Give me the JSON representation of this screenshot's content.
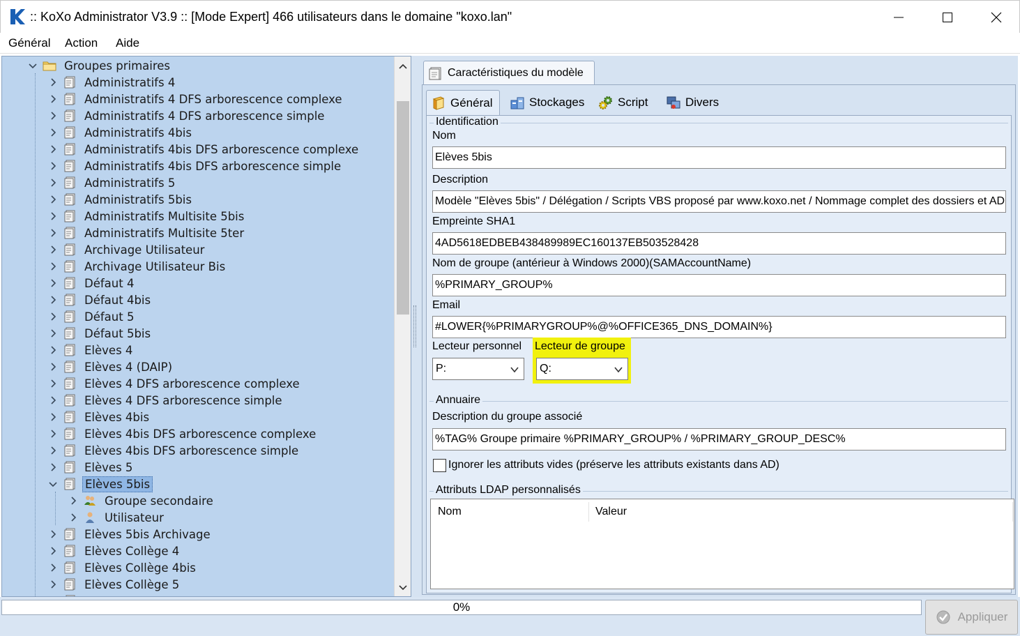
{
  "window": {
    "title": ":: KoXo Administrator V3.9 :: [Mode Expert] 466 utilisateurs dans le domaine \"koxo.lan\""
  },
  "menu": [
    "Général",
    "Action",
    "Aide"
  ],
  "tree": {
    "root_label": "Groupes primaires",
    "items": [
      "Administratifs 4",
      "Administratifs 4 DFS arborescence complexe",
      "Administratifs 4 DFS arborescence simple",
      "Administratifs 4bis",
      "Administratifs 4bis DFS arborescence complexe",
      "Administratifs 4bis DFS arborescence simple",
      "Administratifs 5",
      "Administratifs 5bis",
      "Administratifs Multisite 5bis",
      "Administratifs Multisite 5ter",
      "Archivage Utilisateur",
      "Archivage Utilisateur Bis",
      "Défaut 4",
      "Défaut 4bis",
      "Défaut 5",
      "Défaut 5bis",
      "Elèves 4",
      "Elèves 4 (DAIP)",
      "Elèves 4 DFS arborescence complexe",
      "Elèves 4 DFS arborescence simple",
      "Elèves 4bis",
      "Elèves 4bis DFS arborescence complexe",
      "Elèves 4bis DFS arborescence simple",
      "Elèves 5",
      "Elèves 5bis"
    ],
    "selected_children": [
      "Groupe secondaire",
      "Utilisateur"
    ],
    "items_after": [
      "Elèves 5bis Archivage",
      "Elèves Collège 4",
      "Elèves Collège 4bis",
      "Elèves Collège 5"
    ]
  },
  "outer_tab": "Caractéristiques du modèle",
  "tabs": [
    {
      "label": "Général",
      "icon": "book-icon"
    },
    {
      "label": "Stockages",
      "icon": "storage-icon"
    },
    {
      "label": "Script",
      "icon": "gears-icon"
    },
    {
      "label": "Divers",
      "icon": "misc-icon"
    }
  ],
  "form": {
    "identification_title": "Identification",
    "nom_label": "Nom",
    "nom_value": "Elèves 5bis",
    "description_label": "Description",
    "description_value": "Modèle \"Elèves 5bis\" / Délégation / Scripts VBS proposé par www.koxo.net / Nommage complet des dossiers et AD",
    "sha1_label": "Empreinte SHA1",
    "sha1_value": "4AD5618EDBEB438489989EC160137EB503528428",
    "sam_label": "Nom de groupe (antérieur à Windows 2000)(SAMAccountName)",
    "sam_value": "%PRIMARY_GROUP%",
    "email_label": "Email",
    "email_value": "#LOWER{%PRIMARYGROUP%@%OFFICE365_DNS_DOMAIN%}",
    "lecteur_perso_label": "Lecteur personnel",
    "lecteur_perso_value": "P:",
    "lecteur_groupe_label": "Lecteur de groupe",
    "lecteur_groupe_value": "Q:",
    "annuaire_title": "Annuaire",
    "desc_groupe_label": "Description du groupe associé",
    "desc_groupe_value": "%TAG% Groupe primaire %PRIMARY_GROUP% / %PRIMARY_GROUP_DESC%",
    "ignore_label": "Ignorer les attributs vides (préserve les attributs existants dans AD)",
    "ignore_checked": false,
    "ldap_title": "Attributs LDAP personnalisés",
    "ldap_columns": [
      "Nom",
      "Valeur"
    ]
  },
  "status": {
    "progress_text": "0%",
    "progress": 0,
    "apply_label": "Appliquer"
  },
  "colors": {
    "highlight": "#f1f10e",
    "tree_bg": "#bcd4ee",
    "panel_bg": "#d6e3f2",
    "brand": "#1a5fb4"
  }
}
